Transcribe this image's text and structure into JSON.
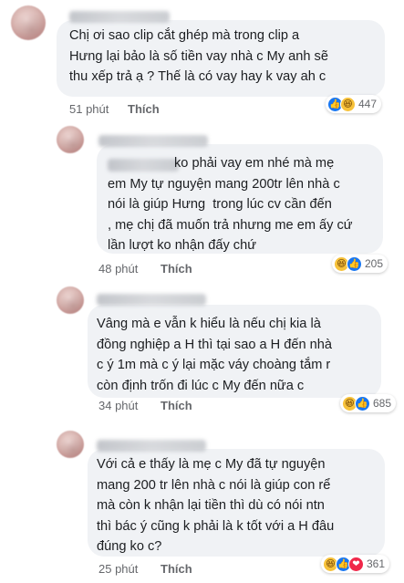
{
  "comments": [
    {
      "text": "Chị ơi sao clip cắt ghép mà trong clip a\nHưng lại bảo là số tiền vay nhà c My anh sẽ\nthu xếp trả ạ ? Thế là có vay hay k vay ah c",
      "time": "51 phút",
      "action": "Thích",
      "reactions": [
        "like-icon",
        "haha-icon"
      ],
      "reaction_count": "447"
    },
    {
      "author": "Khánh Linh",
      "text": "                  ko phải vay em nhé mà mẹ\nem My tự nguyện mang 200tr lên nhà c\nnói là giúp Hưng  trong lúc cv cần đến\n, mẹ chị đã muốn trả nhưng me em ấy cứ\nlần lượt ko nhận đấy chứ",
      "time": "48 phút",
      "action": "Thích",
      "reactions": [
        "haha-icon",
        "like-icon"
      ],
      "reaction_count": "205"
    },
    {
      "text": "Vâng mà e vẫn k hiểu là nếu chị kia là\nđồng nghiệp a H thì tại sao a H đến nhà\nc ý 1m mà c ý lại mặc váy choàng tắm r\ncòn định trốn đi lúc c My đến nữa c",
      "time": "34 phút",
      "action": "Thích",
      "reactions": [
        "haha-icon",
        "like-icon"
      ],
      "reaction_count": "685"
    },
    {
      "author": "Khánh Linh",
      "text": "Với cả e thấy là mẹ c My đã tự nguyện\nmang 200 tr lên nhà c nói là giúp con rể\nmà còn k nhận lại tiền thì dù có nói ntn\nthì bác ý cũng k phải là k tốt với a H đâu\nđúng ko c?",
      "time": "25 phút",
      "action": "Thích",
      "reactions": [
        "haha-icon",
        "like-icon",
        "love-icon"
      ],
      "reaction_count": "361"
    }
  ]
}
